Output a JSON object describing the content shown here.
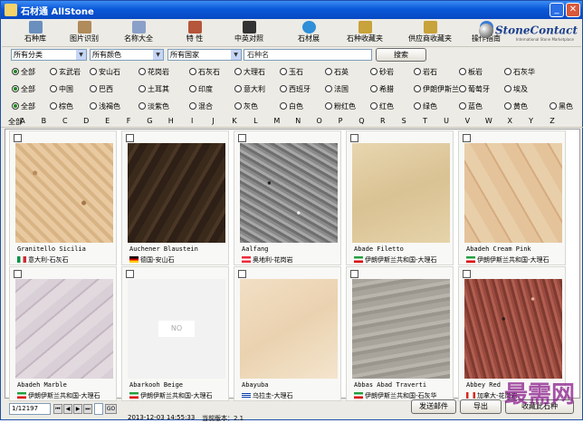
{
  "window": {
    "title": "石材通 AllStone"
  },
  "toolbar": [
    {
      "label": "石种库",
      "icon": "books-icon"
    },
    {
      "label": "图片识别",
      "icon": "photo-icon"
    },
    {
      "label": "名称大全",
      "icon": "pen-icon"
    },
    {
      "label": "特 性",
      "icon": "fire-icon"
    },
    {
      "label": "中英对照",
      "icon": "translate-icon"
    },
    {
      "label": "石材展",
      "icon": "globe-icon"
    },
    {
      "label": "石种收藏夹",
      "icon": "bookmark-icon"
    },
    {
      "label": "供应商收藏夹",
      "icon": "supplier-icon"
    },
    {
      "label": "操作指南",
      "icon": "help-icon"
    }
  ],
  "brand": {
    "name": "StoneContact",
    "tagline": "International Stone Marketplace"
  },
  "filters": {
    "category": "所有分类",
    "color": "所有颜色",
    "country": "所有国家",
    "search_value": "石种名",
    "search_button": "搜索"
  },
  "radio_rows": [
    [
      "全部",
      "玄武岩",
      "安山石",
      "花岗岩",
      "石灰石",
      "大理石",
      "玉石",
      "石英",
      "砂岩",
      "岩石",
      "板岩",
      "石灰华"
    ],
    [
      "全部",
      "中国",
      "巴西",
      "土耳其",
      "印度",
      "意大利",
      "西班牙",
      "法国",
      "希腊",
      "伊朗伊斯兰",
      "葡萄牙",
      "埃及"
    ],
    [
      "全部",
      "棕色",
      "浅褐色",
      "淡紫色",
      "混合",
      "灰色",
      "白色",
      "粉红色",
      "红色",
      "绿色",
      "蓝色",
      "黄色",
      "黑色"
    ]
  ],
  "alphabet": [
    "全部",
    "A",
    "B",
    "C",
    "D",
    "E",
    "F",
    "G",
    "H",
    "I",
    "J",
    "K",
    "L",
    "M",
    "N",
    "O",
    "P",
    "Q",
    "R",
    "S",
    "T",
    "U",
    "V",
    "W",
    "X",
    "Y",
    "Z"
  ],
  "stones": [
    {
      "name": "Granitello Sicilia",
      "country": "意大利-石灰石",
      "flag": "italy",
      "image": "beige-speckled"
    },
    {
      "name": "Auchener Blaustein",
      "country": "德国-安山石",
      "flag": "germany",
      "image": "dark-brown"
    },
    {
      "name": "Aalfang",
      "country": "奥地利-花岗岩",
      "flag": "austria",
      "image": "grey-granite"
    },
    {
      "name": "Abade Filetto",
      "country": "伊朗伊斯兰共和国-大理石",
      "flag": "iran",
      "image": "cream"
    },
    {
      "name": "Abadeh Cream Pink",
      "country": "伊朗伊斯兰共和国-大理石",
      "flag": "iran",
      "image": "cream-pink"
    },
    {
      "name": "Abadeh Marble",
      "country": "伊朗伊斯兰共和国-大理石",
      "flag": "iran",
      "image": "lilac-marble"
    },
    {
      "name": "Abarkooh Beige",
      "country": "伊朗伊斯兰共和国-大理石",
      "flag": "iran",
      "image": "no-image",
      "placeholder": "NO"
    },
    {
      "name": "Abayuba",
      "country": "乌拉圭-大理石",
      "flag": "uruguay",
      "image": "light-beige"
    },
    {
      "name": "Abbas Abad Traverti",
      "country": "伊朗伊斯兰共和国-石灰华",
      "flag": "iran",
      "image": "grey-travertine"
    },
    {
      "name": "Abbey Red",
      "country": "加拿大-花岗岩",
      "flag": "canada",
      "image": "red-granite"
    }
  ],
  "pagination": {
    "page": "1/12197",
    "go": "GO"
  },
  "bottom_buttons": {
    "send_email": "发送邮件",
    "export": "导出",
    "favorite": "收藏此石种"
  },
  "status": {
    "date": "2013-12-03 14:55:33",
    "version_label": "当前版本：",
    "version": "2.1"
  },
  "watermark": "最需网",
  "colors": {
    "titlebar": "#0a58d8",
    "brand": "#1a3f8f",
    "radio_selected": "#1a8a1a"
  }
}
